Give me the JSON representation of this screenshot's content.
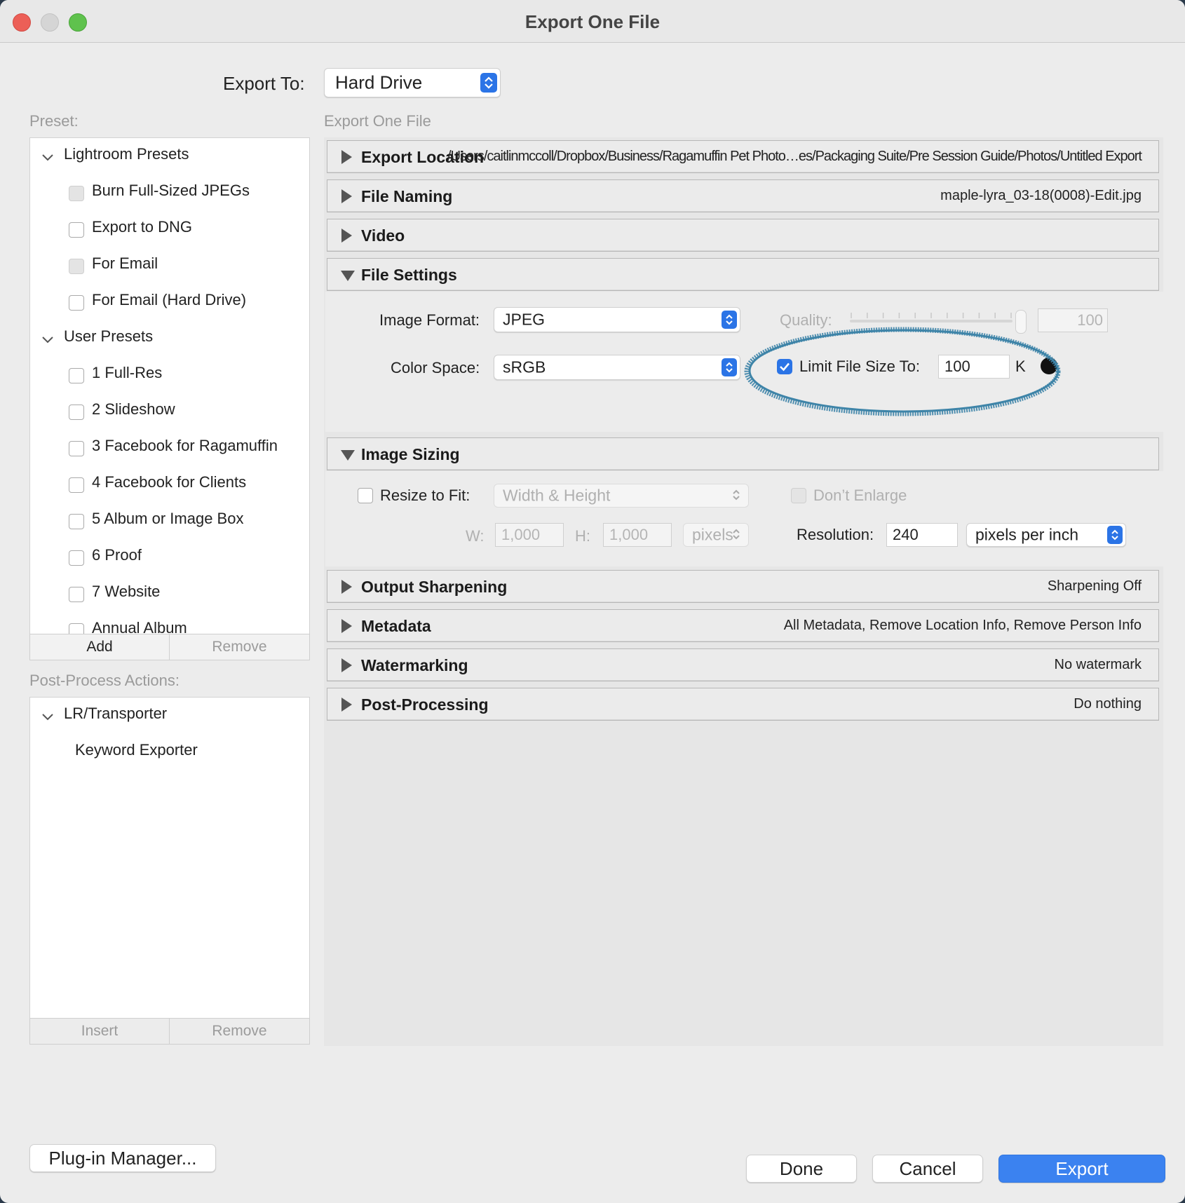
{
  "window": {
    "title": "Export One File"
  },
  "export_to": {
    "label": "Export To:",
    "value": "Hard Drive"
  },
  "sidebar": {
    "preset_label": "Preset:",
    "groups": [
      {
        "name": "Lightroom Presets",
        "items": [
          "Burn Full-Sized JPEGs",
          "Export to DNG",
          "For Email",
          "For Email (Hard Drive)"
        ]
      },
      {
        "name": "User Presets",
        "items": [
          "1 Full-Res",
          "2 Slideshow",
          "3 Facebook for Ragamuffin",
          "4 Facebook for Clients",
          "5 Album or Image Box",
          "6 Proof",
          "7 Website",
          "Annual Album"
        ]
      }
    ],
    "add_label": "Add",
    "remove_label": "Remove",
    "post_process_label": "Post-Process Actions:",
    "post_group": "LR/Transporter",
    "post_item": "Keyword Exporter",
    "insert_label": "Insert",
    "remove2_label": "Remove"
  },
  "main": {
    "header": "Export One File",
    "sections": {
      "export_location": {
        "name": "Export Location",
        "summary": "/Users/caitlinmccoll/Dropbox/Business/Ragamuffin Pet Photo…es/Packaging Suite/Pre Session Guide/Photos/Untitled Export"
      },
      "file_naming": {
        "name": "File Naming",
        "summary": "maple-lyra_03-18(0008)-Edit.jpg"
      },
      "video": {
        "name": "Video"
      },
      "file_settings": {
        "name": "File Settings"
      },
      "image_sizing": {
        "name": "Image Sizing"
      },
      "output_sharpening": {
        "name": "Output Sharpening",
        "summary": "Sharpening Off"
      },
      "metadata": {
        "name": "Metadata",
        "summary": "All Metadata, Remove Location Info, Remove Person Info"
      },
      "watermarking": {
        "name": "Watermarking",
        "summary": "No watermark"
      },
      "post_processing": {
        "name": "Post-Processing",
        "summary": "Do nothing"
      }
    },
    "file_settings": {
      "image_format_label": "Image Format:",
      "image_format_value": "JPEG",
      "quality_label": "Quality:",
      "quality_value": "100",
      "color_space_label": "Color Space:",
      "color_space_value": "sRGB",
      "limit_label": "Limit File Size To:",
      "limit_value": "100",
      "limit_unit": "K",
      "limit_checked": true,
      "annotation_color": "#3e84a8"
    },
    "image_sizing": {
      "resize_label": "Resize to Fit:",
      "resize_value": "Width & Height",
      "dont_enlarge_label": "Don’t Enlarge",
      "w_label": "W:",
      "w_value": "1,000",
      "h_label": "H:",
      "h_value": "1,000",
      "unit_value": "pixels",
      "resolution_label": "Resolution:",
      "resolution_value": "240",
      "resolution_unit": "pixels per inch"
    }
  },
  "footer": {
    "plugin_manager": "Plug-in Manager...",
    "done": "Done",
    "cancel": "Cancel",
    "export": "Export"
  },
  "colors": {
    "accent": "#3b82f0",
    "window_bg": "#ececec"
  }
}
